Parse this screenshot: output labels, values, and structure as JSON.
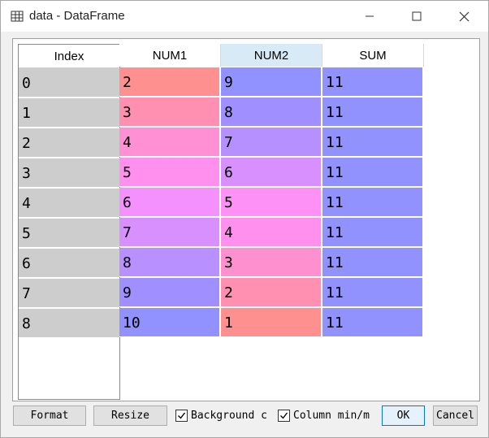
{
  "window": {
    "title": "data - DataFrame"
  },
  "table": {
    "index_header": "Index",
    "columns": [
      "NUM1",
      "NUM2",
      "SUM"
    ],
    "selected_column": "NUM2",
    "rows": [
      {
        "index": "0",
        "cells": [
          "2",
          "9",
          "11"
        ],
        "colors": [
          "#ff9090",
          "#9191ff",
          "#9292ff"
        ]
      },
      {
        "index": "1",
        "cells": [
          "3",
          "8",
          "11"
        ],
        "colors": [
          "#ff90b2",
          "#a090ff",
          "#9292ff"
        ]
      },
      {
        "index": "2",
        "cells": [
          "4",
          "7",
          "11"
        ],
        "colors": [
          "#ff90d3",
          "#b790ff",
          "#9292ff"
        ]
      },
      {
        "index": "3",
        "cells": [
          "5",
          "6",
          "11"
        ],
        "colors": [
          "#ff90ee",
          "#d890ff",
          "#9292ff"
        ]
      },
      {
        "index": "4",
        "cells": [
          "6",
          "5",
          "11"
        ],
        "colors": [
          "#f590ff",
          "#ff90f5",
          "#9292ff"
        ]
      },
      {
        "index": "5",
        "cells": [
          "7",
          "4",
          "11"
        ],
        "colors": [
          "#d890ff",
          "#ff90ee",
          "#9292ff"
        ]
      },
      {
        "index": "6",
        "cells": [
          "8",
          "3",
          "11"
        ],
        "colors": [
          "#b990ff",
          "#ff90d0",
          "#9292ff"
        ]
      },
      {
        "index": "7",
        "cells": [
          "9",
          "2",
          "11"
        ],
        "colors": [
          "#a090ff",
          "#ff90b2",
          "#9292ff"
        ]
      },
      {
        "index": "8",
        "cells": [
          "10",
          "1",
          "11"
        ],
        "colors": [
          "#9191ff",
          "#ff9090",
          "#9292ff"
        ]
      }
    ]
  },
  "footer": {
    "format_label": "Format",
    "resize_label": "Resize",
    "background_label": "Background c",
    "background_checked": true,
    "column_minmax_label": "Column min/m",
    "column_minmax_checked": true,
    "ok_label": "OK",
    "cancel_label": "Cancel"
  },
  "icons": [
    "table-icon",
    "minimize-icon",
    "maximize-icon",
    "close-icon",
    "checkmark-icon"
  ]
}
